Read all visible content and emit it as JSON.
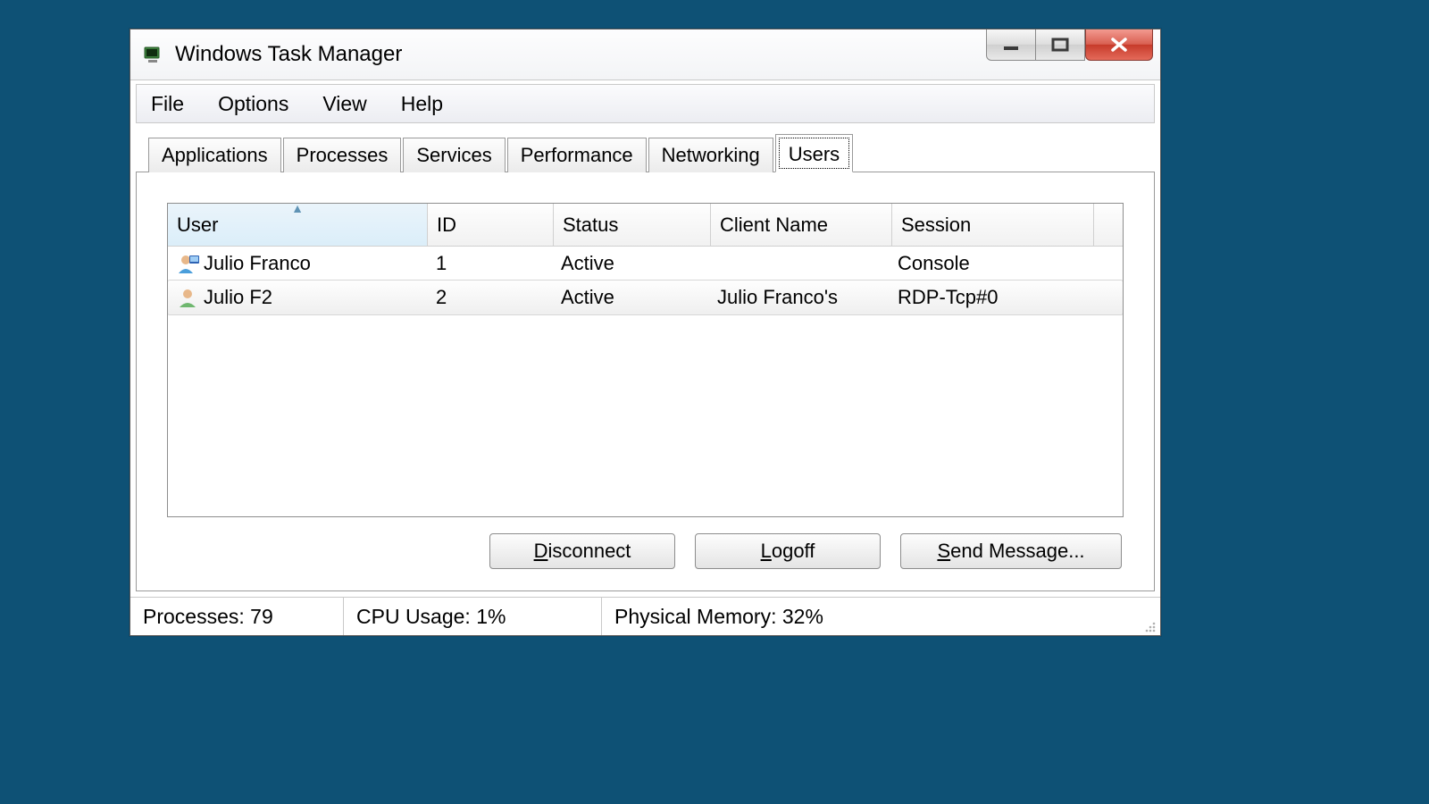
{
  "window": {
    "title": "Windows Task Manager"
  },
  "menu": {
    "file": "File",
    "options": "Options",
    "view": "View",
    "help": "Help"
  },
  "tabs": {
    "applications": "Applications",
    "processes": "Processes",
    "services": "Services",
    "performance": "Performance",
    "networking": "Networking",
    "users": "Users",
    "active": "users"
  },
  "columns": {
    "user": "User",
    "id": "ID",
    "status": "Status",
    "client": "Client Name",
    "session": "Session"
  },
  "rows": [
    {
      "user": "Julio Franco",
      "id": "1",
      "status": "Active",
      "client": "",
      "session": "Console",
      "selected": false,
      "iconVariant": "local"
    },
    {
      "user": "Julio F2",
      "id": "2",
      "status": "Active",
      "client": "Julio Franco's",
      "session": "RDP-Tcp#0",
      "selected": true,
      "iconVariant": "remote"
    }
  ],
  "buttons": {
    "disconnect": "Disconnect",
    "logoff": "Logoff",
    "sendmsg": "Send Message..."
  },
  "status": {
    "processes_label": "Processes:",
    "processes_value": "79",
    "cpu_label": "CPU Usage:",
    "cpu_value": "1%",
    "mem_label": "Physical Memory:",
    "mem_value": "32%"
  }
}
